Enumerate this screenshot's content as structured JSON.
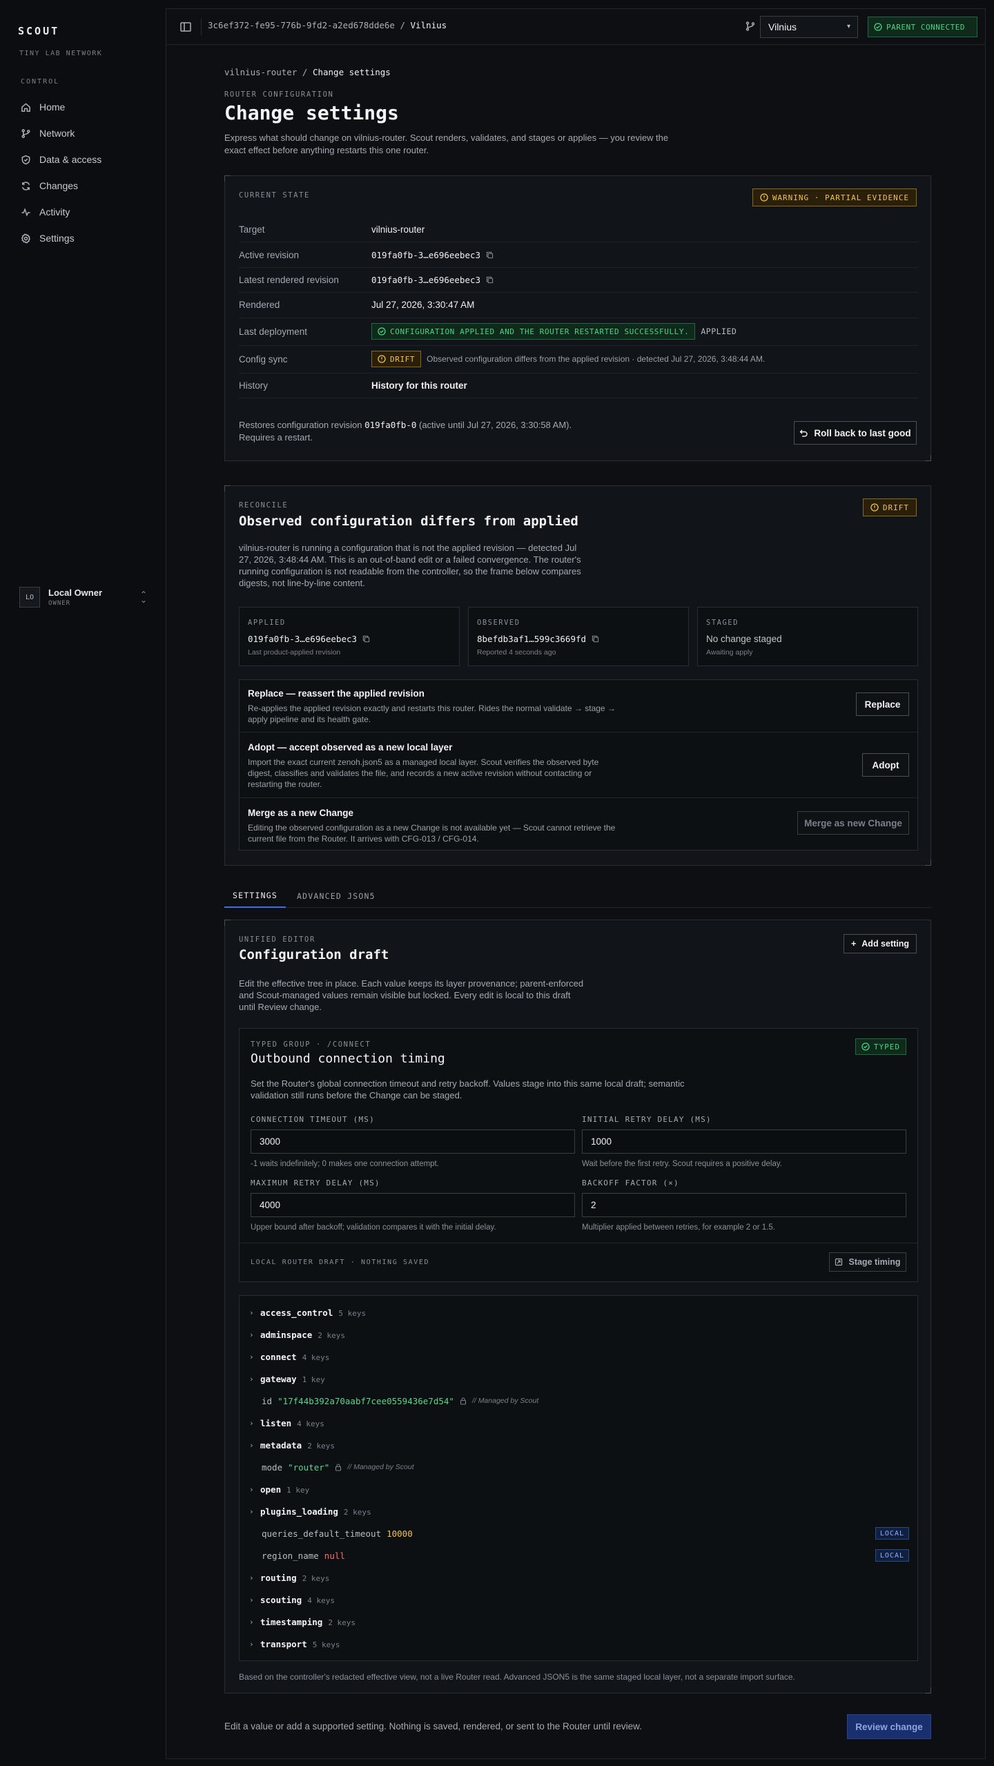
{
  "brand": {
    "name": "SCOUT",
    "subtitle": "TINY LAB NETWORK"
  },
  "sidebar": {
    "section_label": "CONTROL",
    "items": [
      {
        "label": "Home",
        "icon": "home-icon"
      },
      {
        "label": "Network",
        "icon": "network-icon"
      },
      {
        "label": "Data & access",
        "icon": "shield-icon"
      },
      {
        "label": "Changes",
        "icon": "refresh-icon"
      },
      {
        "label": "Activity",
        "icon": "activity-icon"
      },
      {
        "label": "Settings",
        "icon": "gear-icon"
      }
    ],
    "account": {
      "initials": "LO",
      "name": "Local Owner",
      "role": "OWNER"
    }
  },
  "topbar": {
    "router_id": "3c6ef372-fe95-776b-9fd2-a2ed678dde6e",
    "separator": "/",
    "site": "Vilnius",
    "site_select_value": "Vilnius",
    "parent_status": "PARENT CONNECTED"
  },
  "breadcrumb": {
    "parent": "vilnius-router",
    "separator": "/",
    "current": "Change settings"
  },
  "page": {
    "eyebrow": "ROUTER CONFIGURATION",
    "title": "Change settings",
    "description": "Express what should change on vilnius-router. Scout renders, validates, and stages or applies — you review the exact effect before anything restarts this one router."
  },
  "current_state": {
    "eyebrow": "CURRENT STATE",
    "badge": "WARNING · PARTIAL EVIDENCE",
    "rows": {
      "target": {
        "label": "Target",
        "value": "vilnius-router"
      },
      "active_revision": {
        "label": "Active revision",
        "value": "019fa0fb-3…e696eebec3"
      },
      "latest_rendered": {
        "label": "Latest rendered revision",
        "value": "019fa0fb-3…e696eebec3"
      },
      "rendered": {
        "label": "Rendered",
        "value": "Jul 27, 2026, 3:30:47 AM"
      },
      "last_deployment": {
        "label": "Last deployment",
        "pill": "CONFIGURATION APPLIED AND THE ROUTER RESTARTED SUCCESSFULLY.",
        "tag": "APPLIED"
      },
      "config_sync": {
        "label": "Config sync",
        "pill": "DRIFT",
        "note": "Observed configuration differs from the applied revision · detected Jul 27, 2026, 3:48:44 AM."
      },
      "history": {
        "label": "History",
        "value": "History for this router"
      }
    },
    "restore_prefix": "Restores configuration revision",
    "restore_rev": "019fa0fb-0",
    "restore_suffix": "(active until Jul 27, 2026, 3:30:58 AM).",
    "restore_note": "Requires a restart.",
    "rollback_label": "Roll back to last good"
  },
  "reconcile": {
    "eyebrow": "RECONCILE",
    "title": "Observed configuration differs from applied",
    "badge": "DRIFT",
    "description": "vilnius-router is running a configuration that is not the applied revision — detected Jul 27, 2026, 3:48:44 AM. This is an out-of-band edit or a failed convergence. The router's running configuration is not readable from the controller, so the frame below compares digests, not line-by-line content.",
    "applied": {
      "label": "APPLIED",
      "value": "019fa0fb-3…e696eebec3",
      "sub": "Last product-applied revision"
    },
    "observed": {
      "label": "OBSERVED",
      "value": "8befdb3af1…599c3669fd",
      "sub": "Reported 4 seconds ago"
    },
    "staged": {
      "label": "STAGED",
      "value": "No change staged",
      "sub": "Awaiting apply"
    },
    "actions": {
      "replace": {
        "title": "Replace — reassert the applied revision",
        "desc": "Re-applies the applied revision exactly and restarts this router. Rides the normal validate → stage → apply pipeline and its health gate.",
        "button": "Replace"
      },
      "adopt": {
        "title": "Adopt — accept observed as a new local layer",
        "desc": "Import the exact current zenoh.json5 as a managed local layer. Scout verifies the observed byte digest, classifies and validates the file, and records a new active revision without contacting or restarting the router.",
        "button": "Adopt"
      },
      "merge": {
        "title": "Merge as a new Change",
        "desc": "Editing the observed configuration as a new Change is not available yet — Scout cannot retrieve the current file from the Router. It arrives with CFG-013 / CFG-014.",
        "button": "Merge as new Change"
      }
    }
  },
  "tabs": {
    "settings": "SETTINGS",
    "advanced": "ADVANCED JSON5"
  },
  "draft": {
    "eyebrow": "UNIFIED EDITOR",
    "title": "Configuration draft",
    "add_label": "Add setting",
    "description": "Edit the effective tree in place. Each value keeps its layer provenance; parent-enforced and Scout-managed values remain visible but locked. Every edit is local to this draft until Review change.",
    "typed_group": {
      "eyebrow": "TYPED GROUP · /CONNECT",
      "title": "Outbound connection timing",
      "badge": "TYPED",
      "description": "Set the Router's global connection timeout and retry backoff. Values stage into this same local draft; semantic validation still runs before the Change can be staged.",
      "fields": {
        "timeout": {
          "label": "CONNECTION TIMEOUT (MS)",
          "value": "3000",
          "hint": "-1 waits indefinitely; 0 makes one connection attempt."
        },
        "initial": {
          "label": "INITIAL RETRY DELAY (MS)",
          "value": "1000",
          "hint": "Wait before the first retry. Scout requires a positive delay."
        },
        "max": {
          "label": "MAXIMUM RETRY DELAY (MS)",
          "value": "4000",
          "hint": "Upper bound after backoff; validation compares it with the initial delay."
        },
        "factor": {
          "label": "BACKOFF FACTOR (×)",
          "value": "2",
          "hint": "Multiplier applied between retries, for example 2 or 1.5."
        }
      },
      "footer_status": "LOCAL ROUTER DRAFT · NOTHING SAVED",
      "stage_label": "Stage timing"
    },
    "tree": {
      "access_control": {
        "key": "access_control",
        "count": "5 keys"
      },
      "adminspace": {
        "key": "adminspace",
        "count": "2 keys"
      },
      "connect": {
        "key": "connect",
        "count": "4 keys"
      },
      "gateway": {
        "key": "gateway",
        "count": "1 key"
      },
      "gateway_id": {
        "key": "id",
        "value": "\"17f44b392a70aabf7cee0559436e7d54\"",
        "note": "// Managed by Scout"
      },
      "listen": {
        "key": "listen",
        "count": "4 keys"
      },
      "metadata": {
        "key": "metadata",
        "count": "2 keys"
      },
      "metadata_mode": {
        "key": "mode",
        "value": "\"router\"",
        "note": "// Managed by Scout"
      },
      "open": {
        "key": "open",
        "count": "1 key"
      },
      "plugins_loading": {
        "key": "plugins_loading",
        "count": "2 keys"
      },
      "queries_timeout": {
        "key": "queries_default_timeout",
        "value": "10000",
        "tag": "LOCAL"
      },
      "region_name": {
        "key": "region_name",
        "value": "null",
        "tag": "LOCAL"
      },
      "routing": {
        "key": "routing",
        "count": "2 keys"
      },
      "scouting": {
        "key": "scouting",
        "count": "4 keys"
      },
      "timestamping": {
        "key": "timestamping",
        "count": "2 keys"
      },
      "transport": {
        "key": "transport",
        "count": "5 keys"
      }
    },
    "footnote": "Based on the controller's redacted effective view, not a live Router read. Advanced JSON5 is the same staged local layer, not a separate import surface."
  },
  "review": {
    "message": "Edit a value or add a supported setting. Nothing is saved, rendered, or sent to the Router until review.",
    "button": "Review change"
  },
  "colors": {
    "accent": "#3b6ee8",
    "success": "#4ad487",
    "warning": "#f2c14e",
    "danger": "#ff6b6b",
    "local": "#8fb0ff"
  }
}
